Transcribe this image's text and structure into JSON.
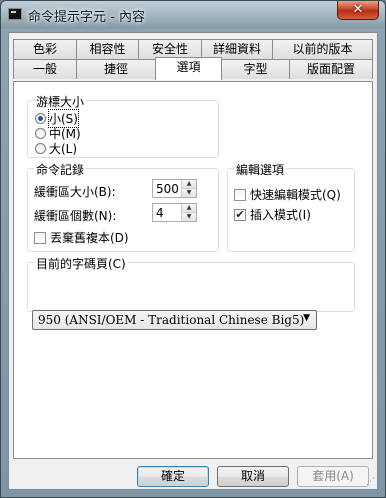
{
  "window": {
    "title": "命令提示字元 - 內容",
    "close_label": "✕"
  },
  "tabs": {
    "row1": [
      "色彩",
      "相容性",
      "安全性",
      "詳細資料",
      "以前的版本"
    ],
    "row2": [
      "一般",
      "捷徑",
      "選項",
      "字型",
      "版面配置"
    ],
    "active": "選項"
  },
  "cursor_size": {
    "title": "游標大小",
    "options": [
      "小(S)",
      "中(M)",
      "大(L)"
    ],
    "selected": "小(S)"
  },
  "command_history": {
    "title": "命令記錄",
    "buffer_size_label": "緩衝區大小(B):",
    "buffer_size_value": "500",
    "buffer_count_label": "緩衝區個數(N):",
    "buffer_count_value": "4",
    "discard_duplicates_label": "丟棄舊複本(D)",
    "discard_duplicates_checked": false
  },
  "edit_options": {
    "title": "編輯選項",
    "quick_edit_label": "快速編輯模式(Q)",
    "quick_edit_checked": false,
    "insert_mode_label": "插入模式(I)",
    "insert_mode_checked": true
  },
  "code_page": {
    "title": "目前的字碼頁(C)",
    "selected": "950   (ANSI/OEM - Traditional Chinese Big5)"
  },
  "buttons": {
    "ok": "確定",
    "cancel": "取消",
    "apply": "套用(A)"
  }
}
